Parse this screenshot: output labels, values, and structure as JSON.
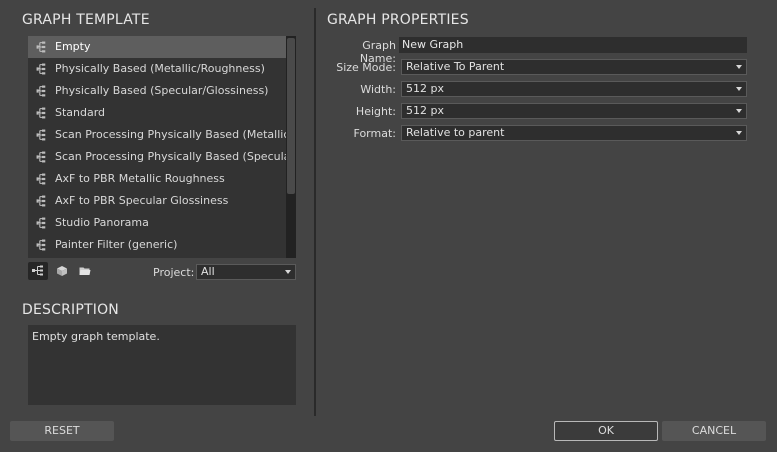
{
  "template": {
    "title": "GRAPH TEMPLATE",
    "items": [
      {
        "label": "Empty",
        "selected": true,
        "icon": "graph-node-icon"
      },
      {
        "label": "Physically Based (Metallic/Roughness)",
        "icon": "graph-node-icon"
      },
      {
        "label": "Physically Based (Specular/Glossiness)",
        "icon": "graph-node-icon"
      },
      {
        "label": "Standard",
        "icon": "graph-node-icon"
      },
      {
        "label": "Scan Processing Physically Based (Metallic/R…",
        "icon": "graph-node-icon"
      },
      {
        "label": "Scan Processing Physically Based (Specular/…",
        "icon": "graph-node-icon"
      },
      {
        "label": "AxF to PBR Metallic Roughness",
        "icon": "graph-node-icon"
      },
      {
        "label": "AxF to PBR Specular Glossiness",
        "icon": "graph-node-icon"
      },
      {
        "label": "Studio Panorama",
        "icon": "graph-node-icon"
      },
      {
        "label": "Painter Filter (generic)",
        "icon": "graph-node-icon"
      }
    ],
    "tools": {
      "graph_icon": "graph-node-icon",
      "model_icon": "cube-icon",
      "folder_icon": "folder-icon"
    },
    "project_label": "Project:",
    "project_value": "All"
  },
  "description": {
    "title": "DESCRIPTION",
    "text": "Empty graph template."
  },
  "properties": {
    "title": "GRAPH PROPERTIES",
    "graph_name_label": "Graph Name:",
    "graph_name_value": "New Graph",
    "size_mode_label": "Size Mode:",
    "size_mode_value": "Relative To Parent",
    "width_label": "Width:",
    "width_value": "512 px",
    "height_label": "Height:",
    "height_value": "512 px",
    "format_label": "Format:",
    "format_value": "Relative to parent"
  },
  "buttons": {
    "reset": "RESET",
    "ok": "OK",
    "cancel": "CANCEL"
  },
  "colors": {
    "background": "#444444",
    "panel": "#333333",
    "selection": "#5e5e5e"
  }
}
